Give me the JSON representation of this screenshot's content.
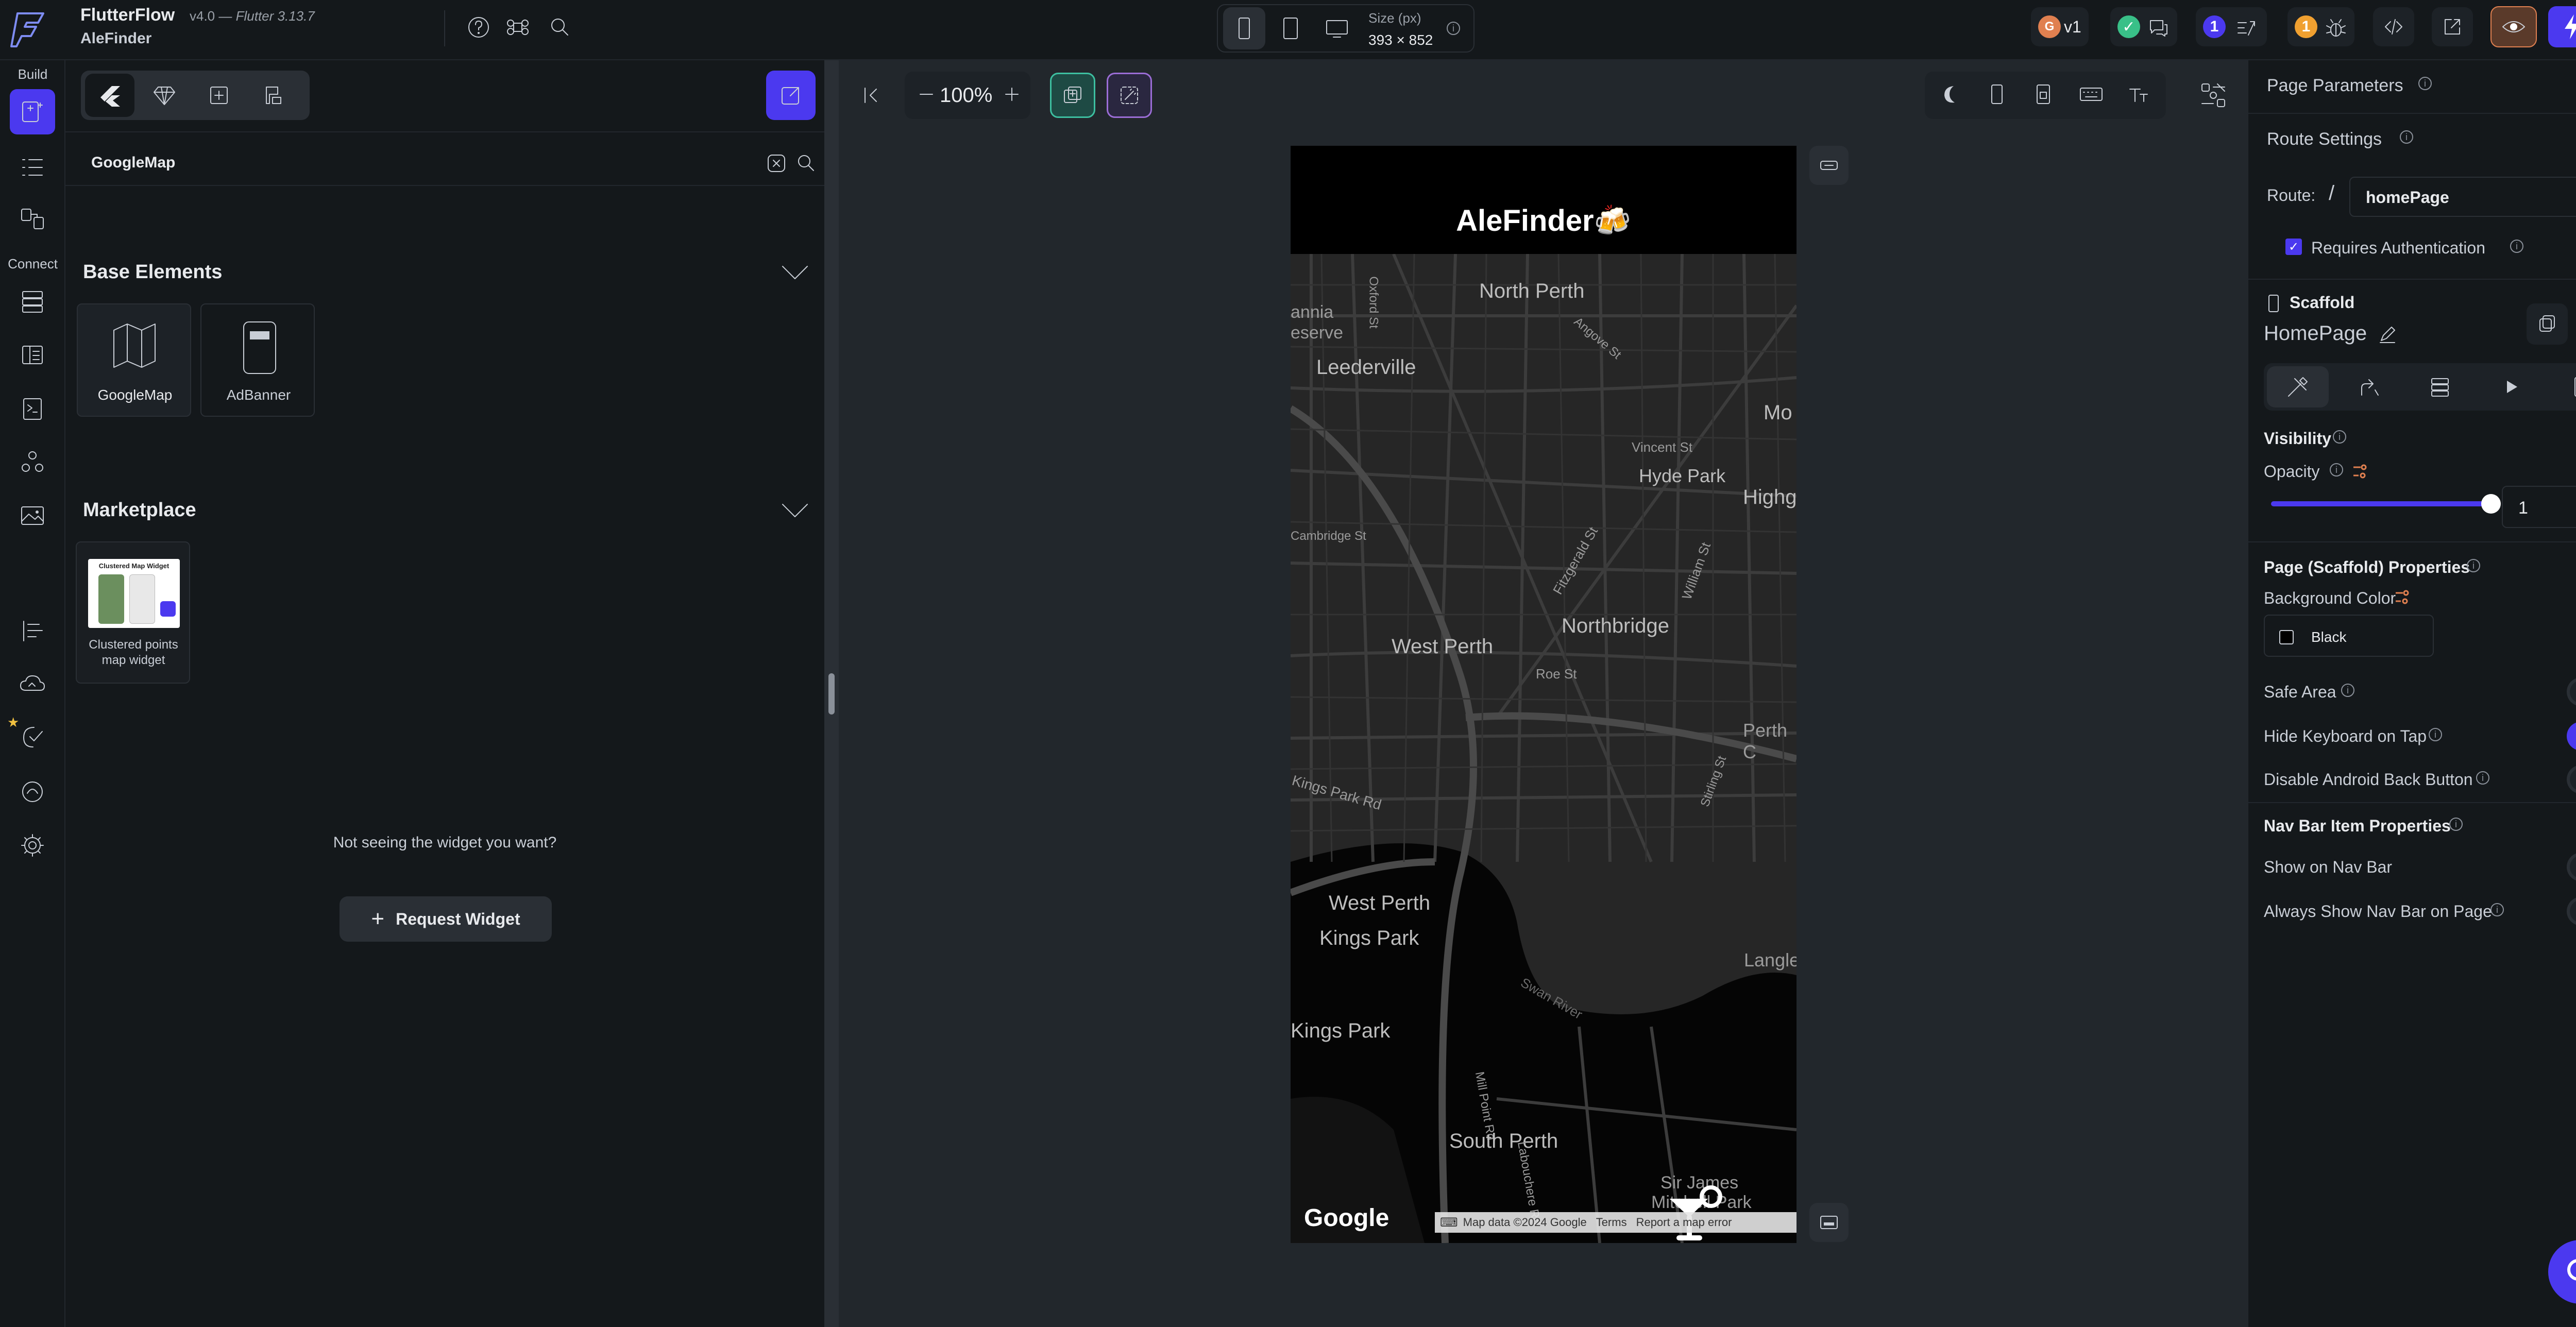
{
  "app": {
    "name": "FlutterFlow",
    "version": "v4.0 —",
    "flutter_version": "Flutter 3.13.7",
    "project": "AleFinder"
  },
  "device": {
    "size_label": "Size (px)",
    "size_value": "393 × 852"
  },
  "topbar_right": {
    "version_tag": "v1",
    "badge_one": "1",
    "badge_two": "1"
  },
  "left_rail": {
    "build_label": "Build",
    "connect_label": "Connect"
  },
  "widget_panel": {
    "search_value": "GoogleMap",
    "base_elements": {
      "title": "Base Elements",
      "items": [
        {
          "label": "GoogleMap",
          "icon": "map-icon"
        },
        {
          "label": "AdBanner",
          "icon": "ad-banner-icon"
        }
      ]
    },
    "marketplace": {
      "title": "Marketplace",
      "items": [
        {
          "label": "Clustered points map widget",
          "thumb_title": "Clustered Map Widget"
        }
      ]
    },
    "not_seeing": "Not seeing the widget you want?",
    "request_button": "Request Widget"
  },
  "canvas": {
    "zoom": "100%",
    "app_title": "AleFinder",
    "app_emoji": "🍻",
    "map_labels": [
      "North Perth",
      "Leederville",
      "Vincent St",
      "Hyde Park",
      "Highg",
      "Mo",
      "Fitzgerald St",
      "William St",
      "West Perth",
      "Northbridge",
      "Roe St",
      "Perth C",
      "Kings Park Rd",
      "West Perth",
      "Kings Park",
      "Kings Park",
      "Langley",
      "Swan River",
      "Mill Point Rd",
      "South Perth",
      "Labouchere Rd",
      "Sir James",
      "Mitchell Park",
      "Oxford St",
      "Angove St",
      "Cambridge St",
      "Stirling St",
      "annia",
      "eserve"
    ],
    "google_logo": "Google",
    "map_footer": [
      "Map data ©2024 Google",
      "Terms",
      "Report a map error"
    ]
  },
  "right_panel": {
    "page_parameters": "Page Parameters",
    "route_settings": "Route Settings",
    "route_label": "Route:",
    "route_slash": "/",
    "route_value": "homePage",
    "requires_auth": "Requires Authentication",
    "requires_auth_checked": true,
    "scaffold_label": "Scaffold",
    "page_name": "HomePage",
    "visibility": "Visibility",
    "opacity_label": "Opacity",
    "opacity_value": "1",
    "opacity_level": 1.0,
    "scaffold_props": "Page (Scaffold) Properties",
    "background_color_label": "Background Color",
    "background_color_value": "Black",
    "background_color_hex": "#000000",
    "toggles": [
      {
        "label": "Safe Area",
        "on": false
      },
      {
        "label": "Hide Keyboard on Tap",
        "on": true
      },
      {
        "label": "Disable Android Back Button",
        "on": false
      }
    ],
    "nav_bar_props": "Nav Bar Item Properties",
    "nav_toggles": [
      {
        "label": "Show on Nav Bar",
        "on": false
      },
      {
        "label": "Always Show Nav Bar on Page",
        "on": false
      }
    ]
  },
  "colors": {
    "accent": "#4b39ef",
    "teal": "#3dbfa0",
    "purple": "#9b6dd6",
    "orange": "#f0a030",
    "green_check": "#39c088"
  }
}
